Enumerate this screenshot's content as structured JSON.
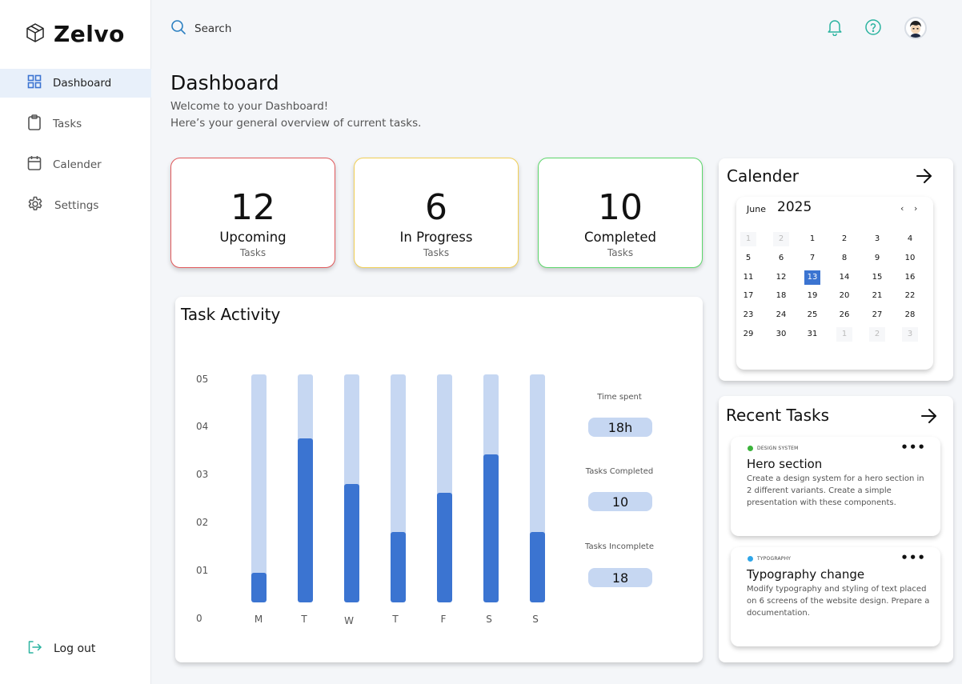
{
  "app": {
    "name": "Zelvo"
  },
  "sidebar": {
    "items": [
      {
        "label": "Dashboard",
        "icon": "grid-icon",
        "active": true
      },
      {
        "label": "Tasks",
        "icon": "clipboard-icon"
      },
      {
        "label": "Calender",
        "icon": "calendar-icon"
      },
      {
        "label": "Settings",
        "icon": "gear-icon"
      }
    ],
    "logout_label": "Log out"
  },
  "topbar": {
    "search_placeholder": "Search",
    "icons": [
      "bell-icon",
      "help-icon",
      "avatar"
    ]
  },
  "header": {
    "title": "Dashboard",
    "welcome": "Welcome to your Dashboard!",
    "overview": "Here’s your general overview of current tasks."
  },
  "stats": [
    {
      "value": "12",
      "label": "Upcoming",
      "sub": "Tasks",
      "border": "#e0585a"
    },
    {
      "value": "6",
      "label": "In Progress",
      "sub": "Tasks",
      "border": "#f1cf55"
    },
    {
      "value": "10",
      "label": "Completed",
      "sub": "Tasks",
      "border": "#5cd66b"
    }
  ],
  "activity": {
    "title": "Task Activity",
    "metrics": [
      {
        "label": "Time spent",
        "value": "18h"
      },
      {
        "label": "Tasks Completed",
        "value": "10"
      },
      {
        "label": "Tasks Incomplete",
        "value": "18"
      }
    ]
  },
  "chart_data": {
    "type": "bar",
    "title": "Task Activity",
    "categories": [
      "M",
      "T",
      "W",
      "T",
      "F",
      "S",
      "S"
    ],
    "y_ticks": [
      "05",
      "04",
      "03",
      "02",
      "01",
      "0"
    ],
    "ylim": [
      0,
      5
    ],
    "series": [
      {
        "values": [
          0.65,
          3.6,
          2.6,
          1.55,
          2.4,
          3.25,
          1.55
        ]
      }
    ],
    "colors": {
      "bar": "#3b74d1",
      "track": "#c6d7f2"
    }
  },
  "calendar": {
    "title": "Calender",
    "month": "June",
    "year": "2025",
    "prev": "‹",
    "next": "›",
    "selected": "13",
    "weeks": [
      [
        "1",
        "2",
        "1",
        "2",
        "3",
        "4"
      ],
      [
        "5",
        "6",
        "7",
        "8",
        "9",
        "10"
      ],
      [
        "11",
        "12",
        "13",
        "14",
        "15",
        "16"
      ],
      [
        "17",
        "18",
        "19",
        "20",
        "21",
        "22"
      ],
      [
        "23",
        "24",
        "25",
        "26",
        "27",
        "28"
      ],
      [
        "29",
        "30",
        "31",
        "1",
        "2",
        "3"
      ]
    ]
  },
  "recent_tasks": {
    "title": "Recent Tasks",
    "items": [
      {
        "tag": "DESIGN SYSTEM",
        "tag_color": "#3bb33b",
        "title": "Hero section",
        "desc": "Create a design system for a hero section in 2 different variants. Create a simple presentation with these components.",
        "menu": "•••"
      },
      {
        "tag": "TYPOGRAPHY",
        "tag_color": "#2fa6e8",
        "title": "Typography change",
        "desc": "Modify typography and styling of text placed on 6 screens of the website design. Prepare a documentation.",
        "menu": "•••"
      }
    ]
  }
}
